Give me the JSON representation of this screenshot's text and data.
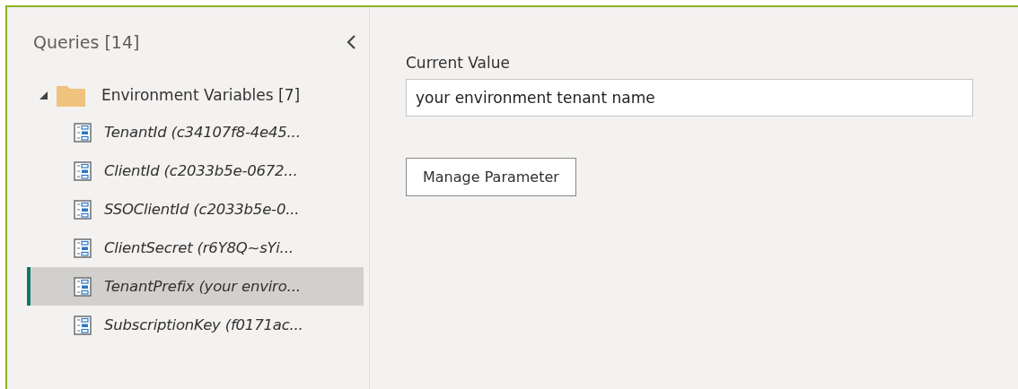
{
  "queries_pane": {
    "title": "Queries [14]",
    "groups": [
      {
        "label": "Environment Variables [7]",
        "expanded": true,
        "items": [
          {
            "label": "TenantId (c34107f8-4e45...",
            "selected": false
          },
          {
            "label": "ClientId (c2033b5e-0672...",
            "selected": false
          },
          {
            "label": "SSOClientId (c2033b5e-0...",
            "selected": false
          },
          {
            "label": "ClientSecret (r6Y8Q~sYi...",
            "selected": false
          },
          {
            "label": "TenantPrefix (your enviro...",
            "selected": true
          },
          {
            "label": "SubscriptionKey (f0171ac...",
            "selected": false
          }
        ]
      }
    ]
  },
  "parameter": {
    "label": "Current Value",
    "value": "your environment tenant name",
    "button": "Manage Parameter"
  }
}
